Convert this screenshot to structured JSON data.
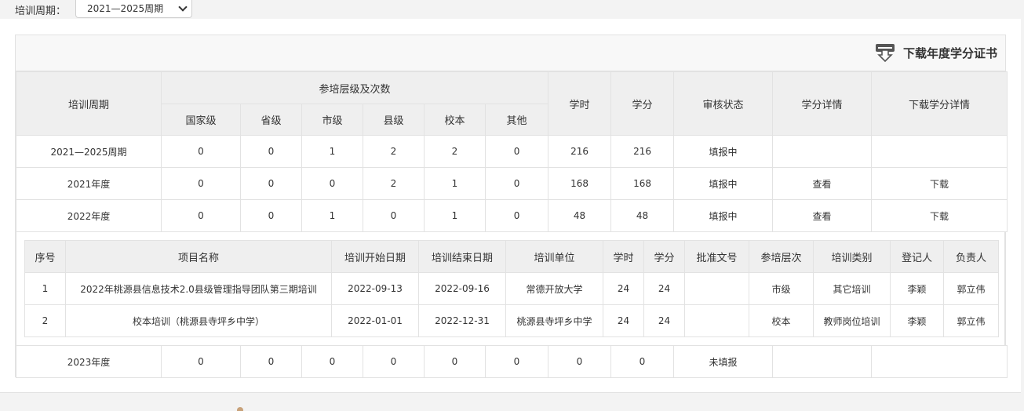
{
  "filter": {
    "label": "培训周期：",
    "selected": "2021—2025周期"
  },
  "header": {
    "download_cert": "下载年度学分证书"
  },
  "main_table": {
    "col_cycle": "培训周期",
    "col_group": "参培层级及次数",
    "sub_cols": [
      "国家级",
      "省级",
      "市级",
      "县级",
      "校本",
      "其他"
    ],
    "col_hours": "学时",
    "col_credits": "学分",
    "col_status": "审核状态",
    "col_detail": "学分详情",
    "col_download": "下载学分详情",
    "rows": [
      {
        "cycle": "2021—2025周期",
        "national": "0",
        "province": "0",
        "city": "1",
        "county": "2",
        "school": "2",
        "other": "0",
        "hours": "216",
        "credits": "216",
        "status": "填报中",
        "detail": "",
        "download": ""
      },
      {
        "cycle": "2021年度",
        "national": "0",
        "province": "0",
        "city": "0",
        "county": "2",
        "school": "1",
        "other": "0",
        "hours": "168",
        "credits": "168",
        "status": "填报中",
        "detail": "查看",
        "download": "下载"
      },
      {
        "cycle": "2022年度",
        "national": "0",
        "province": "0",
        "city": "1",
        "county": "0",
        "school": "1",
        "other": "0",
        "hours": "48",
        "credits": "48",
        "status": "填报中",
        "detail": "查看",
        "download": "下载"
      },
      {
        "cycle": "2023年度",
        "national": "0",
        "province": "0",
        "city": "0",
        "county": "0",
        "school": "0",
        "other": "0",
        "hours": "0",
        "credits": "0",
        "status": "未填报",
        "detail": "",
        "download": ""
      }
    ]
  },
  "sub_table": {
    "headers": [
      "序号",
      "项目名称",
      "培训开始日期",
      "培训结束日期",
      "培训单位",
      "学时",
      "学分",
      "批准文号",
      "参培层次",
      "培训类别",
      "登记人",
      "负责人"
    ],
    "rows": [
      {
        "no": "1",
        "name": "2022年桃源县信息技术2.0县级管理指导团队第三期培训",
        "start": "2022-09-13",
        "end": "2022-09-16",
        "unit": "常德开放大学",
        "hours": "24",
        "credits": "24",
        "approval": "",
        "level": "市级",
        "category": "其它培训",
        "registrar": "李颖",
        "owner": "郭立伟"
      },
      {
        "no": "2",
        "name": "校本培训（桃源县寺坪乡中学）",
        "start": "2022-01-01",
        "end": "2022-12-31",
        "unit": "桃源县寺坪乡中学",
        "hours": "24",
        "credits": "24",
        "approval": "",
        "level": "校本",
        "category": "教师岗位培训",
        "registrar": "李颖",
        "owner": "郭立伟"
      }
    ]
  }
}
